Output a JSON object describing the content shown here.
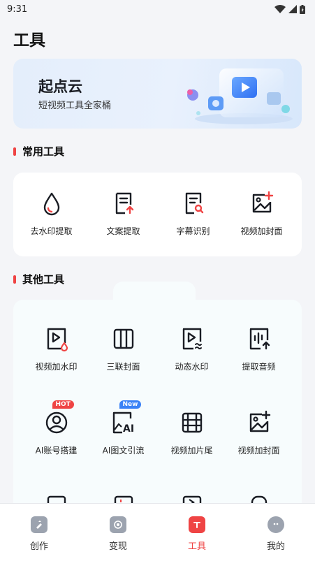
{
  "status": {
    "time": "9:31"
  },
  "page": {
    "title": "工具"
  },
  "banner": {
    "title": "起点云",
    "subtitle": "短视频工具全家桶"
  },
  "sections": {
    "common": {
      "label": "常用工具",
      "tools": [
        {
          "label": "去水印提取",
          "icon": "water-drop-icon"
        },
        {
          "label": "文案提取",
          "icon": "document-upload-icon"
        },
        {
          "label": "字幕识别",
          "icon": "document-search-icon"
        },
        {
          "label": "视频加封面",
          "icon": "image-add-icon"
        }
      ]
    },
    "other": {
      "label": "其他工具",
      "tools": [
        {
          "label": "视频加水印",
          "icon": "video-watermark-icon"
        },
        {
          "label": "三联封面",
          "icon": "triptych-icon"
        },
        {
          "label": "动态水印",
          "icon": "video-wave-icon"
        },
        {
          "label": "提取音频",
          "icon": "audio-extract-icon"
        },
        {
          "label": "AI账号搭建",
          "icon": "account-icon",
          "badge": "HOT"
        },
        {
          "label": "AI图文引流",
          "icon": "ai-image-text-icon",
          "badge": "New"
        },
        {
          "label": "视频加片尾",
          "icon": "film-icon"
        },
        {
          "label": "视频加封面",
          "icon": "image-add-icon"
        }
      ]
    }
  },
  "tabbar": {
    "items": [
      {
        "label": "创作",
        "icon": "create-icon"
      },
      {
        "label": "变现",
        "icon": "monetize-icon"
      },
      {
        "label": "工具",
        "icon": "tools-icon",
        "active": true
      },
      {
        "label": "我的",
        "icon": "profile-icon"
      }
    ]
  },
  "colors": {
    "accent": "#ef4444",
    "badge_new": "#3b82f6",
    "banner_bg": "#e6effb"
  }
}
